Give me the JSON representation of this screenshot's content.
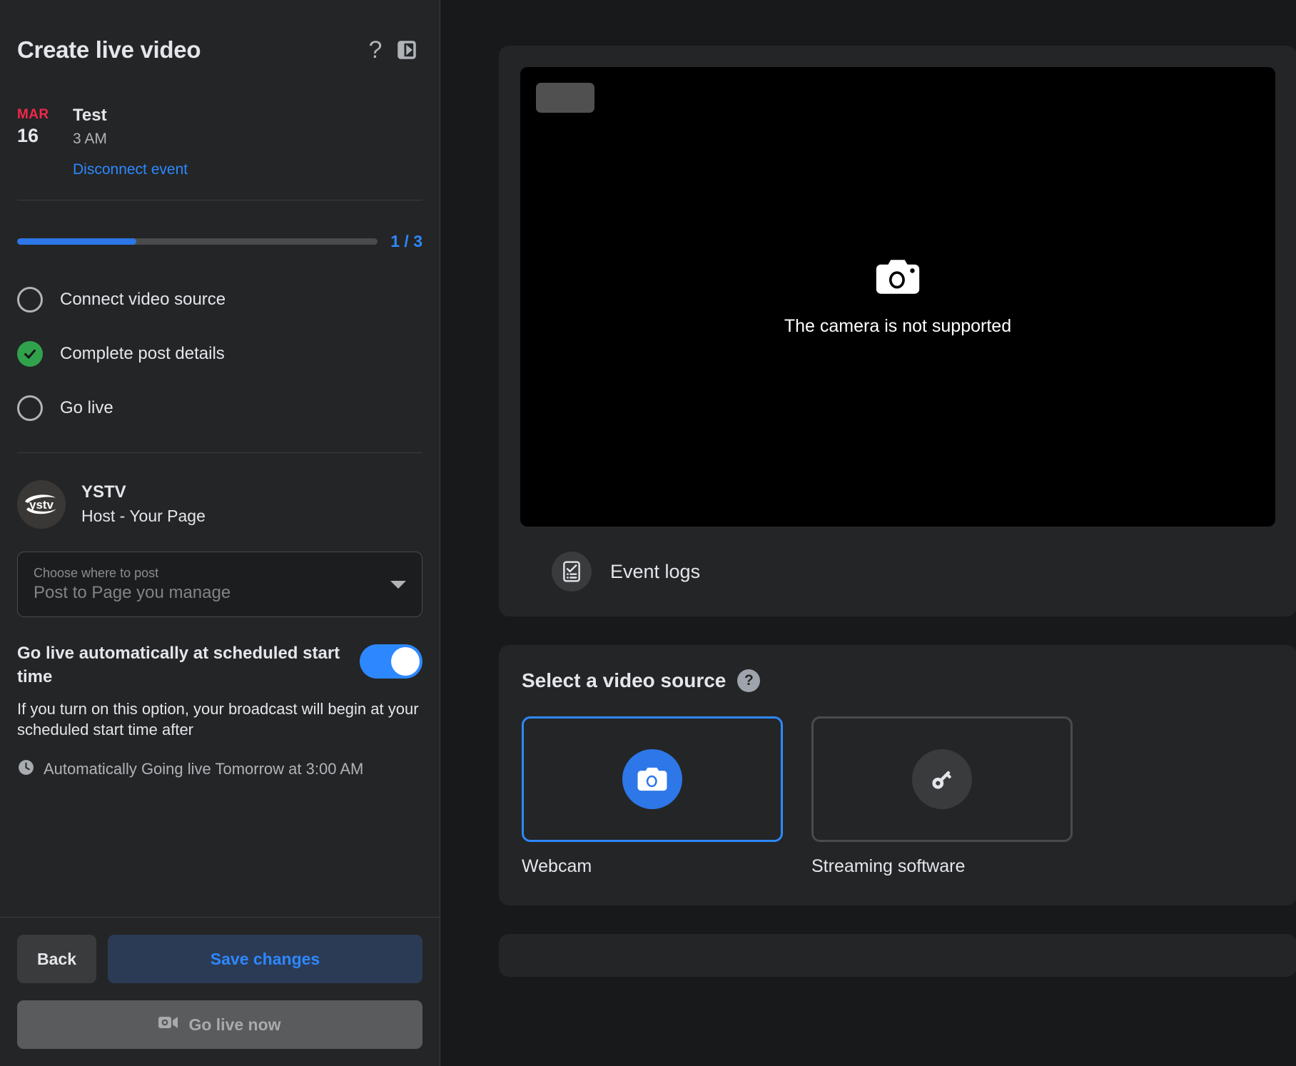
{
  "header": {
    "title": "Create live video",
    "help_icon": "question-mark-icon",
    "panel_toggle_icon": "panel-collapse-icon"
  },
  "event": {
    "month": "MAR",
    "day": "16",
    "name": "Test",
    "time": "3 AM",
    "disconnect_label": "Disconnect event"
  },
  "progress": {
    "percent": 33,
    "count_label": "1 / 3",
    "accent_color": "#2d88ff"
  },
  "steps": [
    {
      "label": "Connect video source",
      "done": false
    },
    {
      "label": "Complete post details",
      "done": true
    },
    {
      "label": "Go live",
      "done": false
    }
  ],
  "host": {
    "avatar_text": "ystv",
    "name": "YSTV",
    "subtitle": "Host - Your Page"
  },
  "post_select": {
    "placeholder": "Choose where to post",
    "value": "Post to Page you manage",
    "caret_icon": "chevron-down-icon"
  },
  "auto_live": {
    "label": "Go live automatically at scheduled start time",
    "toggle_on": true,
    "description": "If you turn on this option, your broadcast will begin at your scheduled start time after",
    "clock_icon": "clock-icon",
    "status": "Automatically Going live Tomorrow at 3:00 AM"
  },
  "footer": {
    "back_label": "Back",
    "save_label": "Save changes",
    "go_live_label": "Go live now",
    "go_live_icon": "video-camera-icon"
  },
  "preview": {
    "chip_icon": "placeholder-chip",
    "camera_icon": "camera-icon",
    "message": "The camera is not supported",
    "event_logs_label": "Event logs",
    "event_logs_icon": "checklist-icon"
  },
  "video_source": {
    "title": "Select a video source",
    "help_icon": "question-mark-icon",
    "help_glyph": "?",
    "options": [
      {
        "label": "Webcam",
        "icon": "camera-icon",
        "selected": true
      },
      {
        "label": "Streaming software",
        "icon": "stream-key-icon",
        "selected": false
      }
    ]
  },
  "colors": {
    "accent_blue": "#2d88ff",
    "success_green": "#31a24c",
    "date_red": "#f0284a",
    "panel_bg": "#242526",
    "page_bg": "#18191a"
  }
}
